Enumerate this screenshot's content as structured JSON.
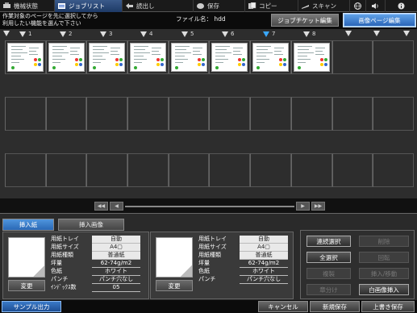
{
  "nav": {
    "tabs": [
      {
        "label": "機械状態",
        "icon": "machine-icon",
        "active": false
      },
      {
        "label": "ジョブリスト",
        "icon": "job-list-icon",
        "active": true
      },
      {
        "label": "読出し",
        "icon": "recall-icon",
        "active": false
      },
      {
        "label": "保存",
        "icon": "store-icon",
        "active": false
      },
      {
        "label": "コピー",
        "icon": "copy-icon",
        "active": false
      },
      {
        "label": "スキャン",
        "icon": "scan-icon",
        "active": false
      }
    ]
  },
  "header": {
    "instruction_line1": "作業対象のページを先に選択してから",
    "instruction_line2": "利用したい機能を選んで下さい",
    "filename_label": "ファイル名：",
    "filename_value": "hdd",
    "job_ticket_button": "ジョブチケット編集",
    "page_edit_button": "画像ページ編集"
  },
  "pages": {
    "markers": [
      "1",
      "2",
      "3",
      "4",
      "5",
      "6",
      "7",
      "8"
    ],
    "selected_marker": "7",
    "thumbnail_count": 8
  },
  "scroll": {
    "first": "◀◀",
    "prev": "◀",
    "next": "▶",
    "last": "▶▶"
  },
  "lower": {
    "tabs": [
      "挿入紙",
      "挿入画像"
    ],
    "active_tab": "挿入紙",
    "left_panel": {
      "rows": [
        {
          "key": "用紙トレイ",
          "value": "自動"
        },
        {
          "key": "用紙サイズ",
          "value": "A4▢"
        },
        {
          "key": "用紙種類",
          "value": "普通紙"
        },
        {
          "key": "坪量",
          "value": "62-74g/m2"
        },
        {
          "key": "色紙",
          "value": "ホワイト"
        },
        {
          "key": "パンチ",
          "value": "パンチ穴なし"
        },
        {
          "key": "ｲﾝﾃﾞｯｸｽ数",
          "value": "05"
        }
      ],
      "change_button": "変更"
    },
    "right_panel": {
      "rows": [
        {
          "key": "用紙トレイ",
          "value": "自動"
        },
        {
          "key": "用紙サイズ",
          "value": "A4▢"
        },
        {
          "key": "用紙種類",
          "value": "普通紙"
        },
        {
          "key": "坪量",
          "value": "62-74g/m2"
        },
        {
          "key": "色紙",
          "value": "ホワイト"
        },
        {
          "key": "パンチ",
          "value": "パンチ穴なし"
        }
      ],
      "change_button": "変更"
    },
    "actions": {
      "continuous_select": "連続選択",
      "select_all": "全選択",
      "duplicate": "複製",
      "chapter": "章分け",
      "delete": "削除",
      "rotate": "回転",
      "insert_move": "挿入/移動",
      "white_page_insert": "白画像挿入"
    }
  },
  "footer": {
    "sample_output": "サンプル出力",
    "cancel": "キャンセル",
    "save_new": "新規保存",
    "overwrite": "上書き保存"
  },
  "colors": {
    "accent_blue": "#2a68b5",
    "selected_marker": "#3aa8ff",
    "grid_bg": "#2d2d2d"
  }
}
